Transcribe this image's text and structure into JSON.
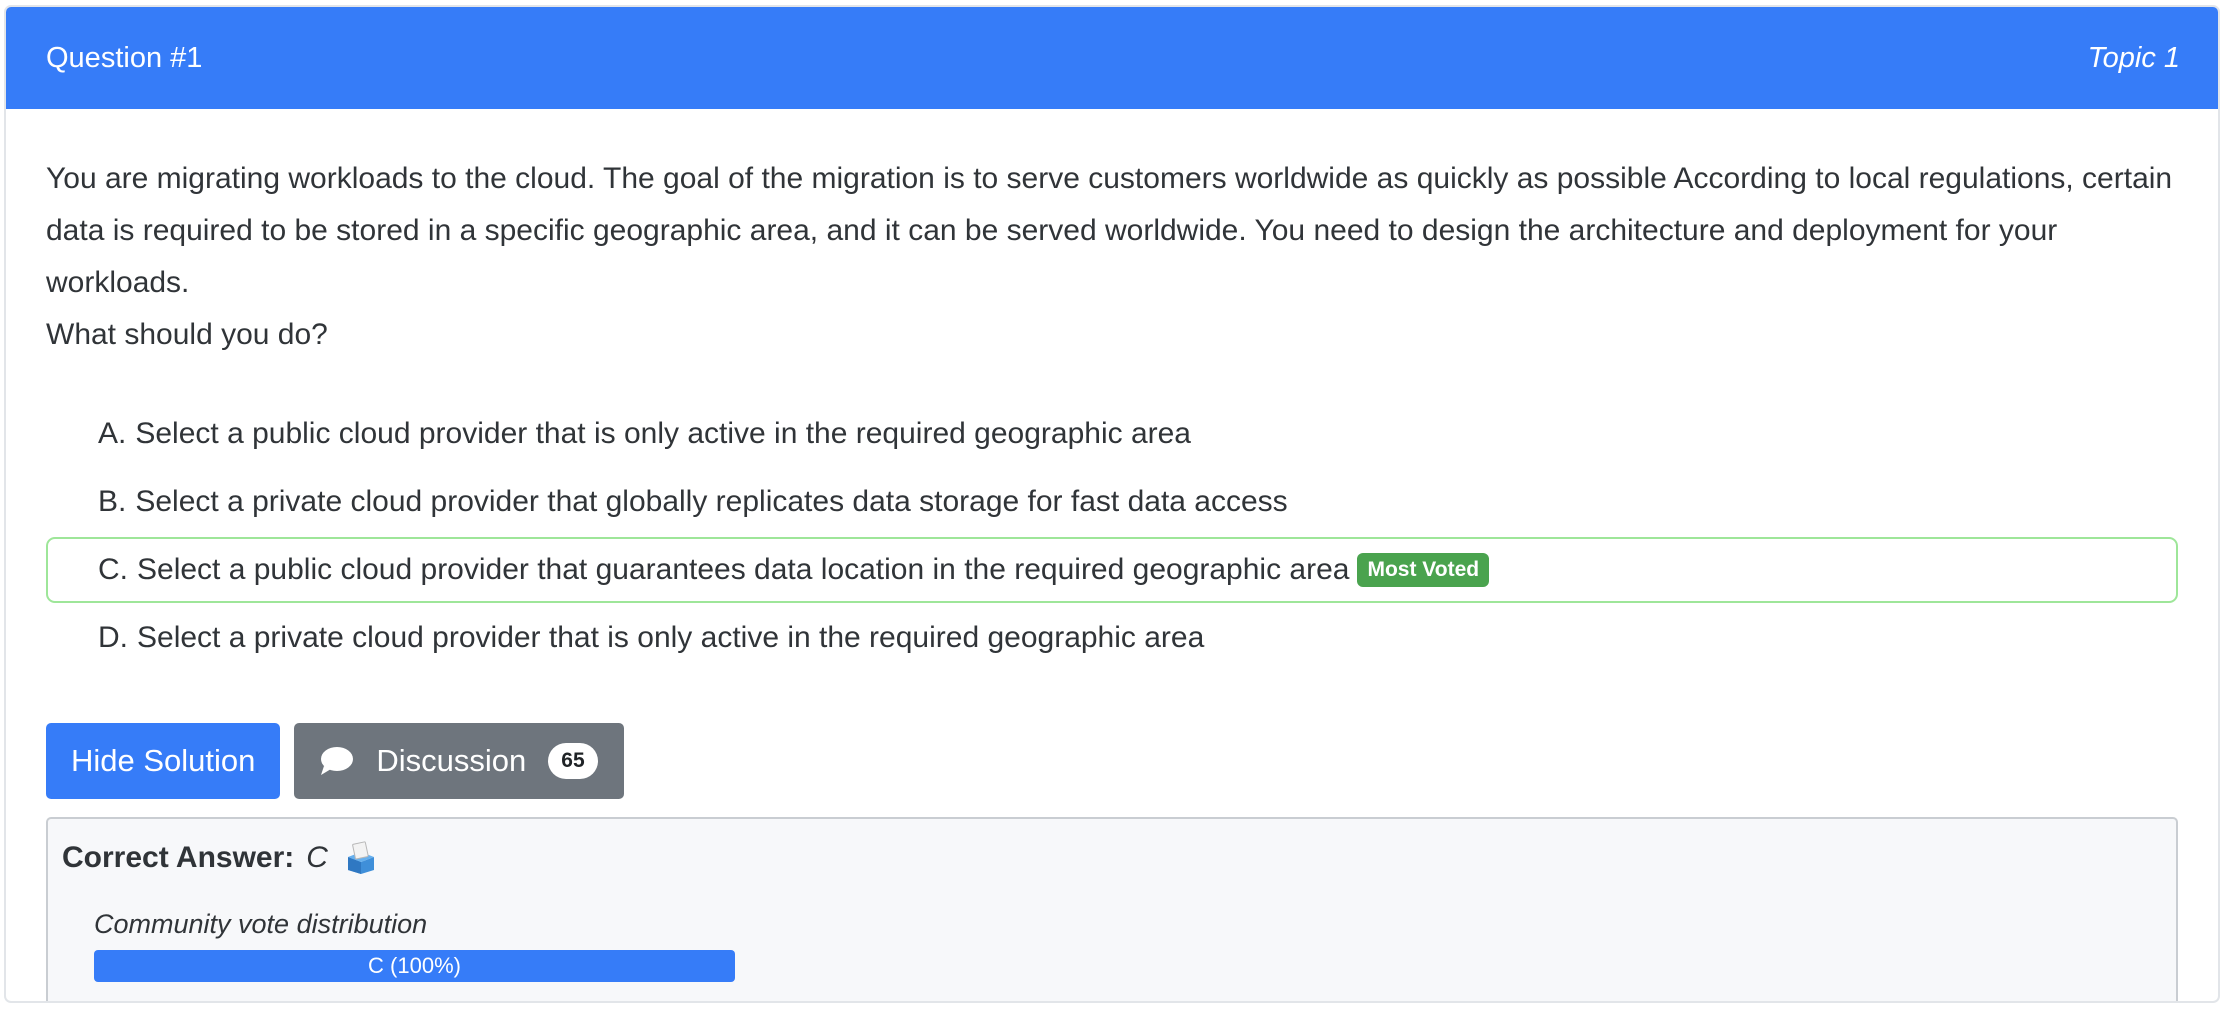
{
  "header": {
    "question_number": "Question #1",
    "topic": "Topic 1"
  },
  "question": {
    "paragraph": "You are migrating workloads to the cloud. The goal of the migration is to serve customers worldwide as quickly as possible According to local regulations, certain data is required to be stored in a specific geographic area, and it can be served worldwide. You need to design the architecture and deployment for your workloads.",
    "prompt": "What should you do?"
  },
  "choices": [
    {
      "letter": "A.",
      "text": "Select a public cloud provider that is only active in the required geographic area"
    },
    {
      "letter": "B.",
      "text": "Select a private cloud provider that globally replicates data storage for fast data access"
    },
    {
      "letter": "C.",
      "text": "Select a public cloud provider that guarantees data location in the required geographic area",
      "badge": "Most Voted"
    },
    {
      "letter": "D.",
      "text": "Select a private cloud provider that is only active in the required geographic area"
    }
  ],
  "actions": {
    "hide_solution": "Hide Solution",
    "discussion": "Discussion",
    "discussion_count": "65"
  },
  "answer": {
    "label": "Correct Answer:",
    "value": "C",
    "vote_label": "Community vote distribution",
    "vote_bar_text": "C (100%)",
    "vote_fraction": 1.0
  },
  "colors": {
    "primary": "#367cf8",
    "secondary": "#6e757d",
    "most_voted": "#4aa34e",
    "voted_border": "#9ee699"
  },
  "icons": [
    "chat-bubble-icon",
    "ballot-box-icon"
  ]
}
